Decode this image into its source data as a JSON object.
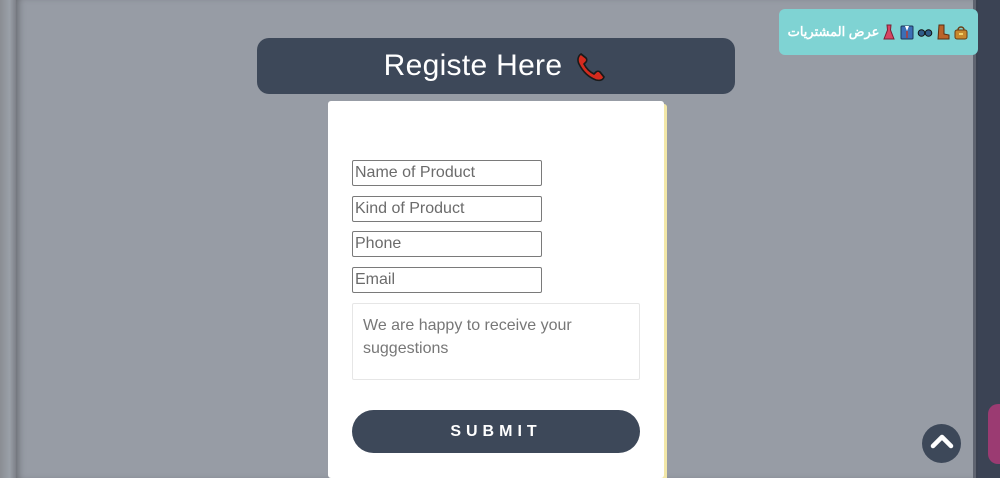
{
  "header": {
    "title": "Registe Here",
    "title_icon": "telephone-receiver-icon"
  },
  "form": {
    "fields": [
      {
        "name": "product-name-input",
        "placeholder": "Name of Product"
      },
      {
        "name": "product-kind-input",
        "placeholder": "Kind of Product"
      },
      {
        "name": "phone-input",
        "placeholder": "Phone"
      },
      {
        "name": "email-input",
        "placeholder": "Email"
      }
    ],
    "suggestions_placeholder": "We are happy to receive your suggestions",
    "submit_label": "SUBMIT"
  },
  "cart_button": {
    "label": "عرض المشتريات",
    "icons": [
      "dress-icon",
      "suit-icon",
      "glasses-icon",
      "boot-icon",
      "handbag-icon"
    ]
  },
  "scroll_top": {
    "icon": "chevron-up-icon"
  },
  "colors": {
    "primary": "#3d4859",
    "overlay": "#979ca5",
    "cart_accent": "#7fd3d3",
    "card_shadow": "#f2e7a8"
  }
}
